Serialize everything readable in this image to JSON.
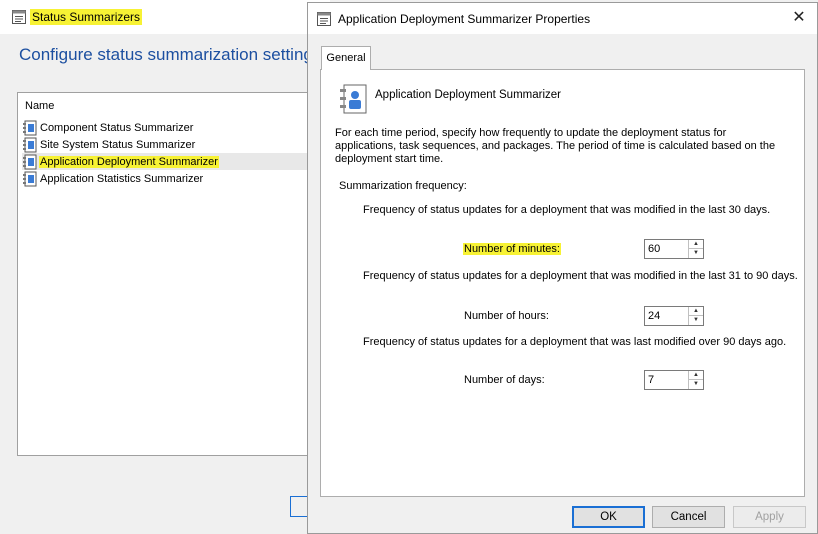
{
  "background_window": {
    "title": "Status Summarizers",
    "heading": "Configure status summarization settings",
    "list_header": "Name",
    "items": [
      {
        "label": "Component Status Summarizer",
        "selected": false
      },
      {
        "label": "Site System Status Summarizer",
        "selected": false
      },
      {
        "label": "Application Deployment Summarizer",
        "selected": true
      },
      {
        "label": "Application Statistics Summarizer",
        "selected": false
      }
    ]
  },
  "dialog": {
    "title": "Application Deployment Summarizer Properties",
    "close_glyph": "✕",
    "tab_label": "General",
    "header_title": "Application Deployment Summarizer",
    "description": "For each time period, specify how frequently to update the deployment status for applications, task sequences, and packages. The period of time is calculated based on the deployment start time.",
    "frequency_label": "Summarization frequency:",
    "periods": [
      {
        "description": "Frequency of status updates for a deployment that was modified in the last 30 days.",
        "unit_label": "Number of minutes:",
        "value": "60"
      },
      {
        "description": "Frequency of status updates for a deployment that was modified in the last 31 to 90 days.",
        "unit_label": "Number of hours:",
        "value": "24"
      },
      {
        "description": "Frequency of status updates for a deployment that was last modified over 90 days ago.",
        "unit_label": "Number of days:",
        "value": "7"
      }
    ],
    "buttons": {
      "ok": "OK",
      "cancel": "Cancel",
      "apply": "Apply"
    }
  },
  "colors": {
    "highlight": "#f7f234",
    "heading": "#1c4fa0",
    "focus": "#1a6fd4"
  },
  "icons": [
    "window-icon",
    "summarizer-icon",
    "close-icon",
    "spin-up-icon",
    "spin-down-icon"
  ]
}
